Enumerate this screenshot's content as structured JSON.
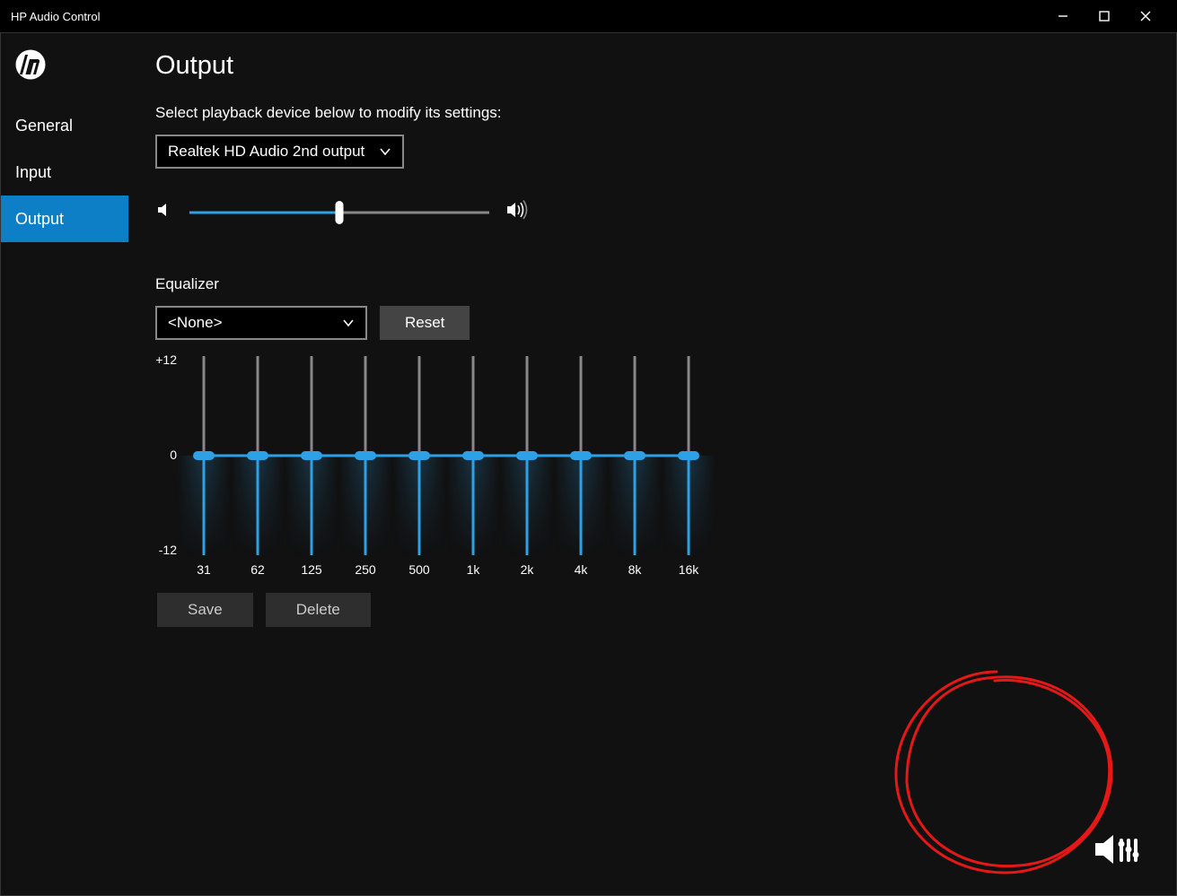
{
  "window": {
    "title": "HP Audio Control"
  },
  "sidebar": {
    "items": [
      {
        "label": "General"
      },
      {
        "label": "Input"
      },
      {
        "label": "Output",
        "active": true
      }
    ]
  },
  "output": {
    "title": "Output",
    "subtitle": "Select playback device below to modify its settings:",
    "device_selected": "Realtek HD Audio 2nd output",
    "volume_percent": 50
  },
  "equalizer": {
    "title": "Equalizer",
    "preset": "<None>",
    "reset_label": "Reset",
    "save_label": "Save",
    "delete_label": "Delete",
    "yaxis": {
      "max": "+12",
      "zero": "0",
      "min": "-12"
    },
    "bands": [
      {
        "freq": "31",
        "value": 0
      },
      {
        "freq": "62",
        "value": 0
      },
      {
        "freq": "125",
        "value": 0
      },
      {
        "freq": "250",
        "value": 0
      },
      {
        "freq": "500",
        "value": 0
      },
      {
        "freq": "1k",
        "value": 0
      },
      {
        "freq": "2k",
        "value": 0
      },
      {
        "freq": "4k",
        "value": 0
      },
      {
        "freq": "8k",
        "value": 0
      },
      {
        "freq": "16k",
        "value": 0
      }
    ]
  }
}
